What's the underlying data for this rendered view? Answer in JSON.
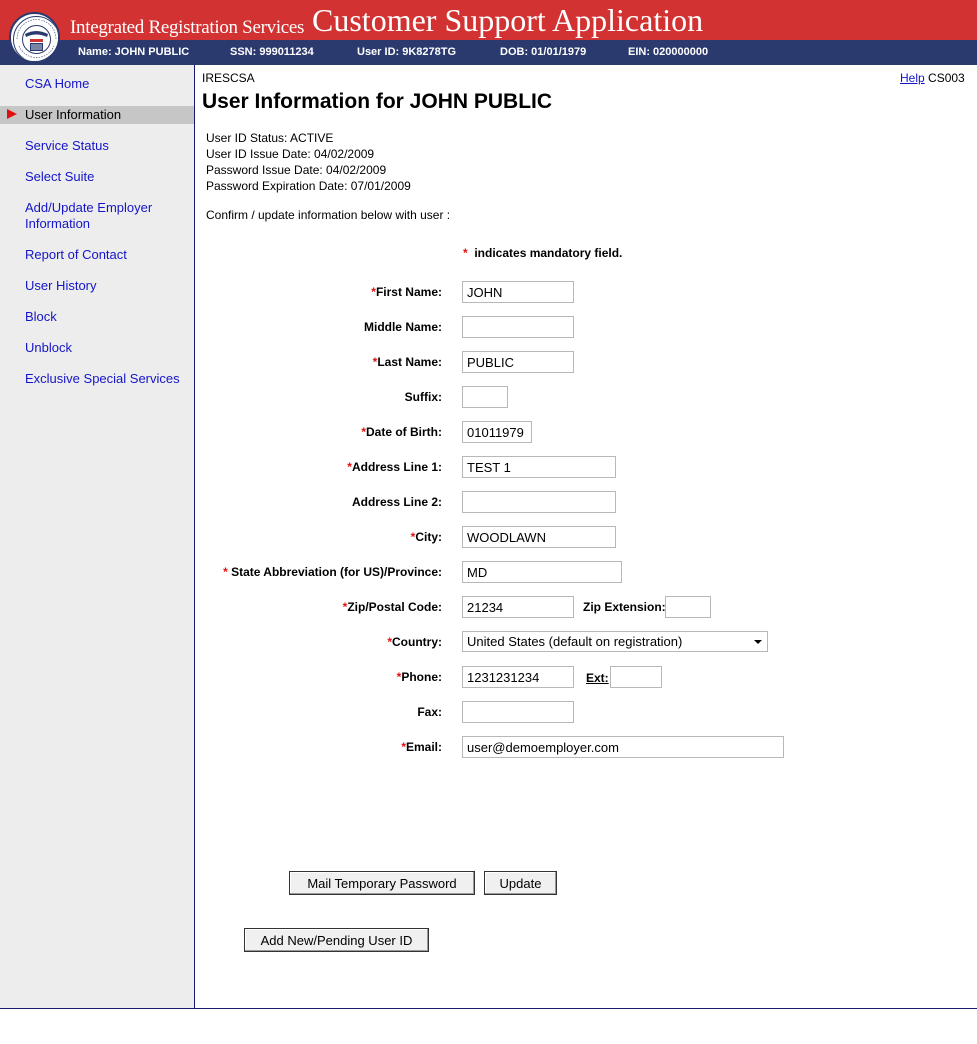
{
  "header": {
    "agency_label": "Integrated Registration Services",
    "app_title": "Customer Support Application",
    "seal_text": "SOCIAL SECURITY ADMINISTRATION USA",
    "fields": {
      "name": "Name: JOHN PUBLIC",
      "ssn": "SSN: 999011234",
      "user_id": "User ID: 9K8278TG",
      "dob": "DOB: 01/01/1979",
      "ein": "EIN: 020000000"
    }
  },
  "sidebar": {
    "items": [
      {
        "label": "CSA Home"
      },
      {
        "label": "User Information",
        "active": true
      },
      {
        "label": "Service Status"
      },
      {
        "label": "Select Suite"
      },
      {
        "label": "Add/Update Employer Information"
      },
      {
        "label": "Report of Contact"
      },
      {
        "label": "User History"
      },
      {
        "label": "Block"
      },
      {
        "label": "Unblock"
      },
      {
        "label": "Exclusive Special Services"
      }
    ]
  },
  "main": {
    "system_code": "IRESCSA",
    "help_label": "Help",
    "screen_code": "CS003",
    "title": "User Information for JOHN PUBLIC",
    "status_lines": [
      "User ID Status: ACTIVE",
      "User ID Issue Date: 04/02/2009",
      "Password Issue Date: 04/02/2009",
      "Password Expiration Date: 07/01/2009"
    ],
    "confirm_text": "Confirm / update information below with user :",
    "mandatory_star": "*",
    "mandatory_note": "indicates mandatory field."
  },
  "form": {
    "first_name": {
      "label": "First Name:",
      "value": "JOHN",
      "required": "*"
    },
    "middle_name": {
      "label": "Middle Name:",
      "value": ""
    },
    "last_name": {
      "label": "Last Name:",
      "value": "PUBLIC",
      "required": "*"
    },
    "suffix": {
      "label": "Suffix:",
      "value": ""
    },
    "dob": {
      "label": "Date of Birth:",
      "value": "01011979",
      "required": "*"
    },
    "address1": {
      "label": "Address Line 1:",
      "value": "TEST 1",
      "required": "*"
    },
    "address2": {
      "label": "Address Line 2:",
      "value": ""
    },
    "city": {
      "label": "City:",
      "value": "WOODLAWN",
      "required": "*"
    },
    "state": {
      "label": "State Abbreviation (for US)/Province:",
      "value": "MD",
      "required": "*"
    },
    "zip": {
      "label": "Zip/Postal Code:",
      "value": "21234",
      "required": "*"
    },
    "zip_ext": {
      "label": "Zip Extension:",
      "value": ""
    },
    "country": {
      "label": "Country:",
      "value": "United States (default on registration)",
      "required": "*"
    },
    "phone": {
      "label": "Phone:",
      "value": "1231231234",
      "required": "*"
    },
    "phone_ext": {
      "label": "Ext:",
      "value": ""
    },
    "fax": {
      "label": "Fax:",
      "value": ""
    },
    "email": {
      "label": "Email:",
      "value": "user@demoemployer.com",
      "required": "*"
    }
  },
  "buttons": {
    "mail_temp_password": "Mail Temporary Password",
    "update": "Update",
    "add_new_user_id": "Add New/Pending User ID"
  },
  "colors": {
    "header_red": "#d23232",
    "header_navy": "#2b3a6e",
    "link_blue": "#1515c8",
    "required_red": "#e01010",
    "sidebar_bg": "#ededed"
  }
}
